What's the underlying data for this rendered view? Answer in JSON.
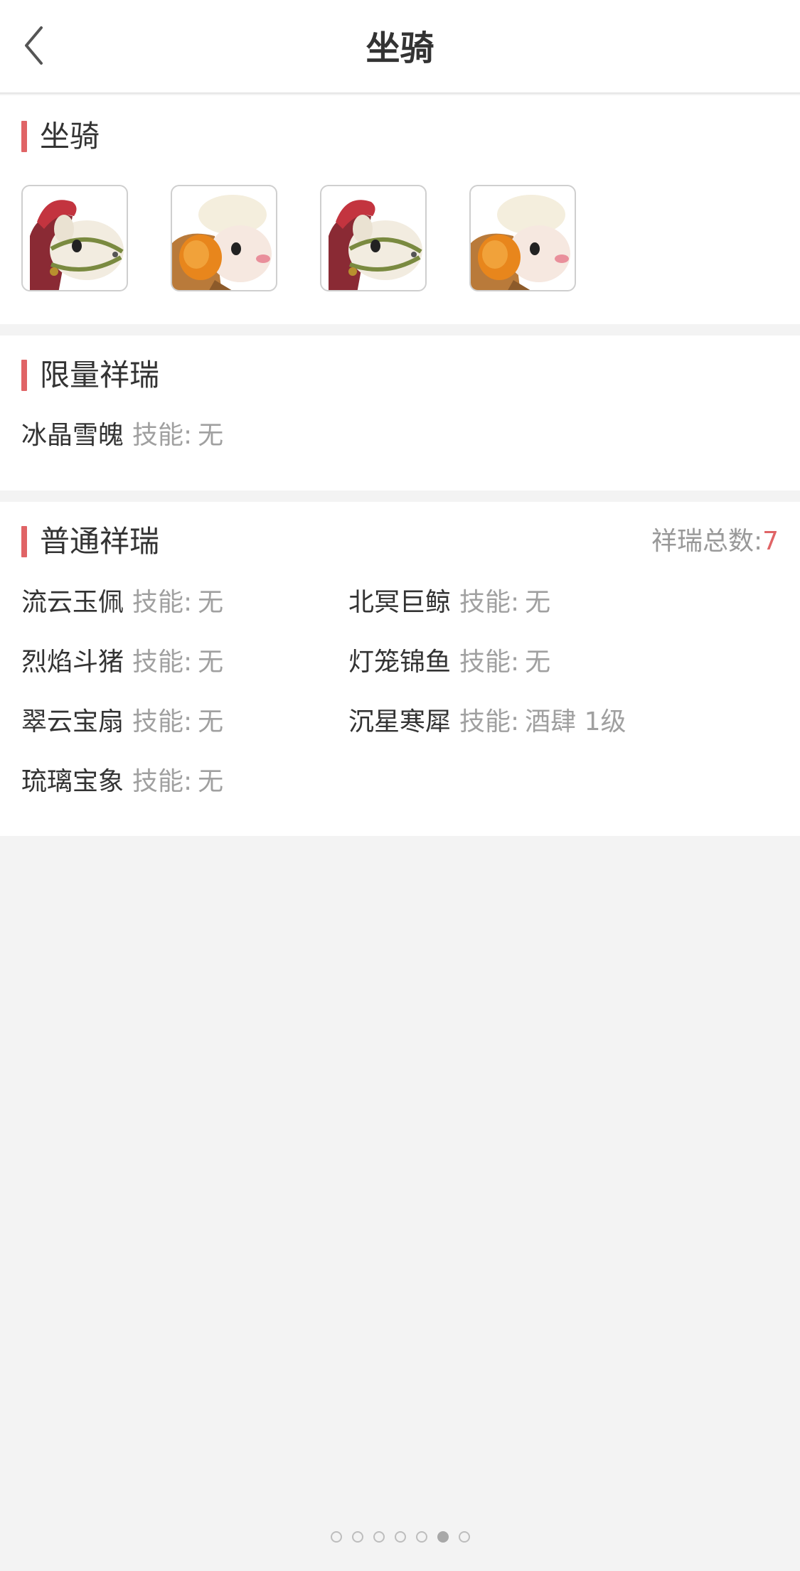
{
  "header": {
    "title": "坐骑",
    "back_icon": "chevron-left-icon"
  },
  "mount_section": {
    "title": "坐骑",
    "icons": [
      {
        "name": "horse-mount-icon"
      },
      {
        "name": "sheep-mount-icon"
      },
      {
        "name": "horse-mount-icon"
      },
      {
        "name": "sheep-mount-icon"
      }
    ]
  },
  "limited_section": {
    "title": "限量祥瑞",
    "items": [
      {
        "name": "冰晶雪魄",
        "skill_label": "技能:",
        "skill": "无"
      }
    ]
  },
  "normal_section": {
    "title": "普通祥瑞",
    "total_label": "祥瑞总数:",
    "total_count": "7",
    "items": [
      {
        "name": "流云玉佩",
        "skill_label": "技能:",
        "skill": "无"
      },
      {
        "name": "北冥巨鲸",
        "skill_label": "技能:",
        "skill": "无"
      },
      {
        "name": "烈焰斗猪",
        "skill_label": "技能:",
        "skill": "无"
      },
      {
        "name": "灯笼锦鱼",
        "skill_label": "技能:",
        "skill": "无"
      },
      {
        "name": "翠云宝扇",
        "skill_label": "技能:",
        "skill": "无"
      },
      {
        "name": "沉星寒犀",
        "skill_label": "技能:",
        "skill": "酒肆 1级"
      },
      {
        "name": "琉璃宝象",
        "skill_label": "技能:",
        "skill": "无"
      }
    ]
  },
  "pager": {
    "count": 7,
    "active_index": 5
  },
  "colors": {
    "accent": "#e06466",
    "muted": "#a0a0a0",
    "background": "#f3f3f3"
  }
}
